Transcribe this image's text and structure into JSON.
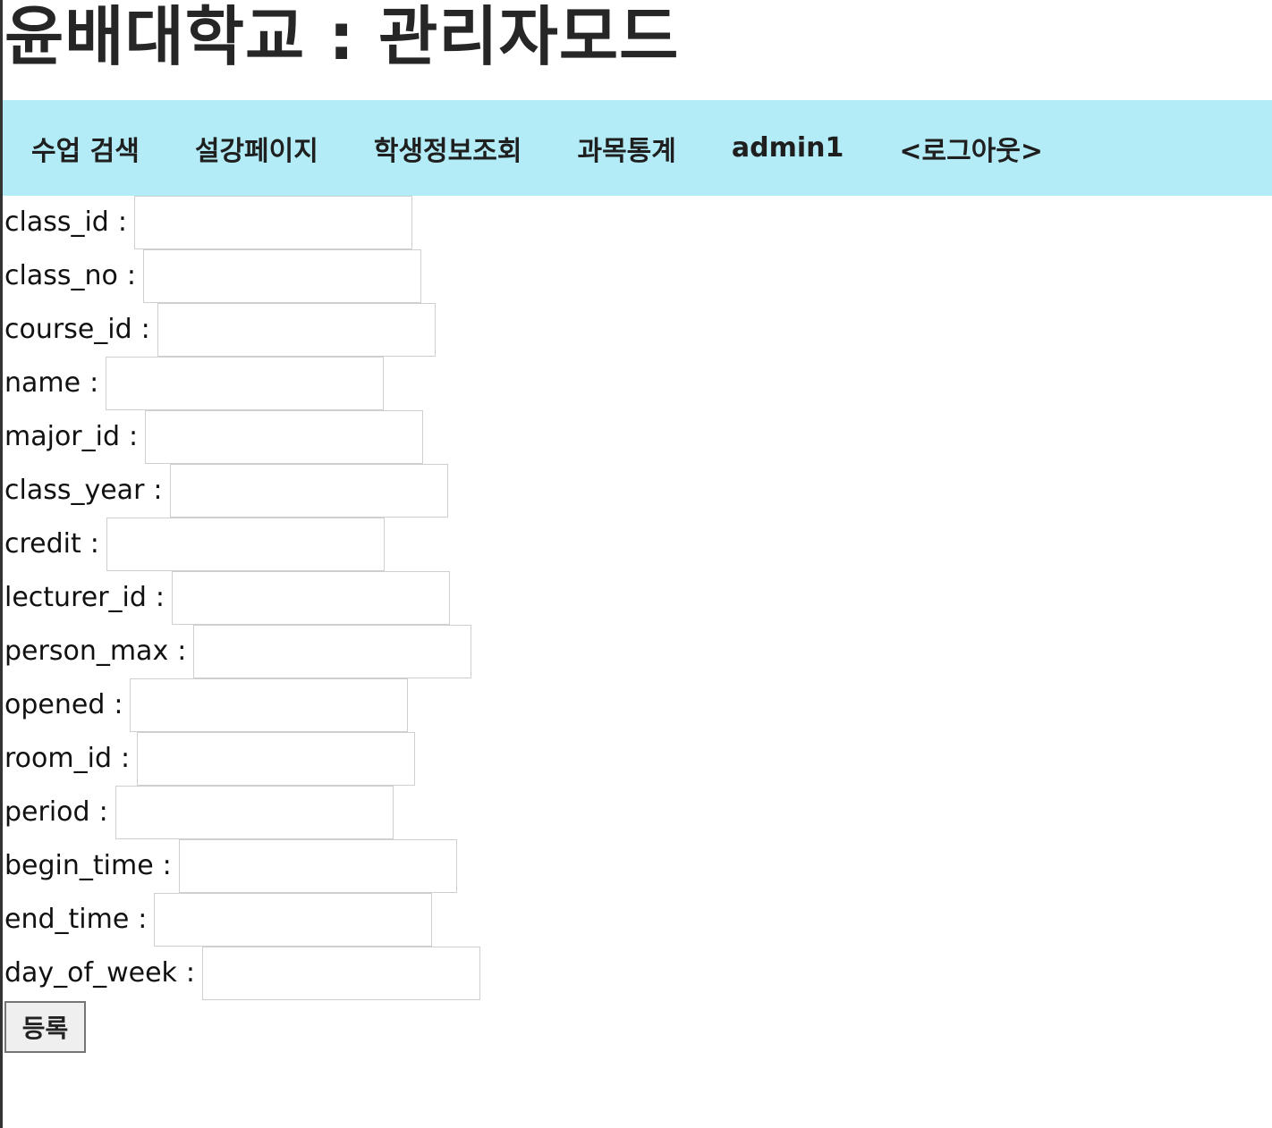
{
  "header": {
    "title": "윤배대학교 : 관리자모드"
  },
  "nav": {
    "items": [
      {
        "label": "수업 검색"
      },
      {
        "label": "설강페이지"
      },
      {
        "label": "학생정보조회"
      },
      {
        "label": "과목통계"
      },
      {
        "label": "admin1"
      },
      {
        "label": "<로그아웃>"
      }
    ]
  },
  "form": {
    "separator": ":",
    "fields": [
      {
        "label": "class_id",
        "value": ""
      },
      {
        "label": "class_no",
        "value": ""
      },
      {
        "label": "course_id",
        "value": ""
      },
      {
        "label": "name",
        "value": ""
      },
      {
        "label": "major_id",
        "value": ""
      },
      {
        "label": "class_year",
        "value": ""
      },
      {
        "label": "credit",
        "value": ""
      },
      {
        "label": "lecturer_id",
        "value": ""
      },
      {
        "label": "person_max",
        "value": ""
      },
      {
        "label": "opened",
        "value": ""
      },
      {
        "label": "room_id",
        "value": ""
      },
      {
        "label": "period",
        "value": ""
      },
      {
        "label": "begin_time",
        "value": ""
      },
      {
        "label": "end_time",
        "value": ""
      },
      {
        "label": "day_of_week",
        "value": ""
      }
    ],
    "submit_label": "등록"
  },
  "colors": {
    "nav_background": "#b3ecf7",
    "button_background": "#efefef"
  }
}
